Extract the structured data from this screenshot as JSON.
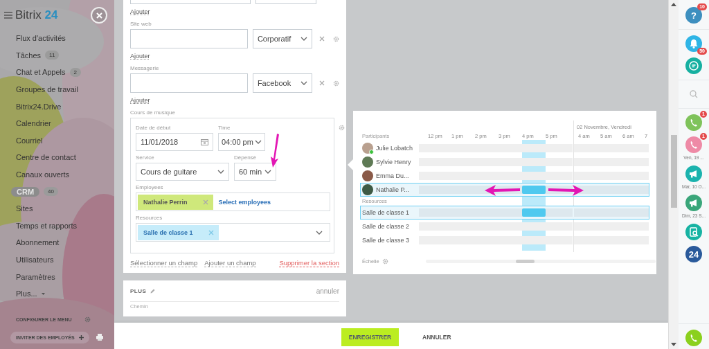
{
  "sidebar": {
    "logo": {
      "word": "Bitrix",
      "number": "24"
    },
    "items": [
      {
        "label": "Flux d'activités",
        "selected": false
      },
      {
        "label": "Tâches",
        "count": "11",
        "selected": false
      },
      {
        "label": "Chat et Appels",
        "count": "2",
        "selected": false
      },
      {
        "label": "Groupes de travail",
        "selected": false
      },
      {
        "label": "Bitrix24.Drive",
        "selected": false
      },
      {
        "label": "Calendrier",
        "selected": false
      },
      {
        "label": "Courriel",
        "selected": false
      },
      {
        "label": "Centre de contact",
        "selected": false
      },
      {
        "label": "Canaux ouverts",
        "selected": false
      },
      {
        "label": "CRM",
        "count": "40",
        "selected": true
      },
      {
        "label": "Sites",
        "selected": false
      },
      {
        "label": "Temps et rapports",
        "selected": false
      },
      {
        "label": "Abonnement",
        "selected": false
      },
      {
        "label": "Utilisateurs",
        "selected": false
      },
      {
        "label": "Paramètres",
        "selected": false
      },
      {
        "label": "Plus...",
        "kind": "more",
        "selected": false
      }
    ],
    "configure": "CONFIGURER LE MENU",
    "invite": "INVITER DES EMPLOYÉS"
  },
  "contact_fields": [
    {
      "add_link": "Ajouter"
    },
    {
      "label": "Site web",
      "type_value": "Corporatif",
      "add_link": "Ajouter"
    },
    {
      "label": "Messagerie",
      "type_value": "Facebook",
      "add_link": "Ajouter"
    }
  ],
  "booking": {
    "title": "Cours de musique",
    "start_label": "Date de début",
    "start_value": "11/01/2018",
    "time_label": "Time",
    "time_value": "04:00 pm",
    "service_label": "Service",
    "service_value": "Cours de guitare",
    "duration_label": "Dépensé",
    "duration_value": "60 min",
    "employees_label": "Employees",
    "employees": [
      {
        "name": "Nathalie Perrin"
      }
    ],
    "employees_link": "Select employees",
    "resources_label": "Resources",
    "resources": [
      {
        "name": "Salle de classe 1"
      }
    ]
  },
  "form_links": [
    {
      "text": "Sélectionner un champ",
      "kind": "normal"
    },
    {
      "text": "Ajouter un champ",
      "kind": "normal"
    },
    {
      "text": "Supprimer la section",
      "kind": "danger"
    }
  ],
  "more_section": {
    "title": "PLUS",
    "cancel": "annuler",
    "field_label": "Chemin"
  },
  "footer": {
    "buttons": [
      {
        "label": "ENREGISTRER",
        "kind": "primary"
      },
      {
        "label": "ANNULER",
        "kind": "plain"
      }
    ]
  },
  "planner": {
    "participants_label": "Participants",
    "hours": [
      {
        "label": "12 pm",
        "selected": false
      },
      {
        "label": "1 pm",
        "selected": false
      },
      {
        "label": "2 pm",
        "selected": false
      },
      {
        "label": "3 pm",
        "selected": false
      },
      {
        "label": "4 pm",
        "selected": true
      },
      {
        "label": "5 pm",
        "selected": false
      }
    ],
    "next_day_label": "02 Novembre, Vendredi",
    "next_day_hours": [
      "4 am",
      "5 am",
      "6 am",
      "7"
    ],
    "participants": [
      {
        "name": "Julie Lobatch",
        "online": true,
        "selected": false,
        "booked": false
      },
      {
        "name": "Sylvie Henry",
        "online": false,
        "selected": false,
        "booked": false
      },
      {
        "name": "Emma Du...",
        "online": false,
        "selected": false,
        "booked": false
      },
      {
        "name": "Nathalie P...",
        "online": false,
        "selected": true,
        "booked": true
      }
    ],
    "resources_label": "Resources",
    "resources": [
      {
        "name": "Salle de classe 1",
        "selected": true,
        "booked": true
      },
      {
        "name": "Salle de classe 2",
        "selected": false,
        "booked": false
      },
      {
        "name": "Salle de classe 3",
        "selected": false,
        "booked": false
      }
    ],
    "scale_label": "Échelle"
  },
  "annotation_arrows": [
    {
      "kind": "down"
    },
    {
      "kind": "left"
    },
    {
      "kind": "right"
    }
  ],
  "right_bar": {
    "items": [
      {
        "kind": "help",
        "label": "?",
        "color": "#3d8fbf",
        "badge": "10"
      },
      {
        "kind": "bell",
        "color": "#2fb5e6",
        "badge": "50"
      },
      {
        "kind": "chat",
        "color": "#16b0a1"
      },
      {
        "kind": "search"
      },
      {
        "kind": "call",
        "color": "#7fc35b",
        "badge": "1"
      },
      {
        "kind": "call",
        "color": "#ee8aa6",
        "badge": "1",
        "caption": "Ven, 19 ..."
      },
      {
        "kind": "megaphone",
        "color": "#1bb3ae",
        "caption": "Mar, 10 O..."
      },
      {
        "kind": "megaphone",
        "color": "#3aa67a",
        "caption": "Dim, 23 S..."
      },
      {
        "kind": "doc-search",
        "color": "#17b3a3"
      },
      {
        "kind": "logo",
        "label": "24",
        "color": "#2a5a9b"
      }
    ],
    "bottom_item": {
      "kind": "call",
      "color": "#8bd01e"
    }
  }
}
